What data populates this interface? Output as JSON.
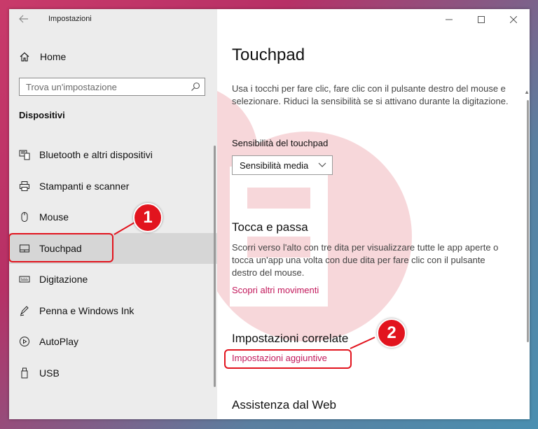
{
  "window": {
    "title": "Impostazioni",
    "controls": [
      "minimize-icon",
      "maximize-icon",
      "close-icon"
    ]
  },
  "sidebar": {
    "home_label": "Home",
    "search_placeholder": "Trova un'impostazione",
    "section_label": "Dispositivi",
    "items": [
      {
        "label": "Bluetooth e altri dispositivi",
        "icon": "bluetooth-devices-icon"
      },
      {
        "label": "Stampanti e scanner",
        "icon": "printer-icon"
      },
      {
        "label": "Mouse",
        "icon": "mouse-icon"
      },
      {
        "label": "Touchpad",
        "icon": "touchpad-icon",
        "selected": true
      },
      {
        "label": "Digitazione",
        "icon": "keyboard-icon"
      },
      {
        "label": "Penna e Windows Ink",
        "icon": "pen-icon"
      },
      {
        "label": "AutoPlay",
        "icon": "autoplay-icon"
      },
      {
        "label": "USB",
        "icon": "usb-icon"
      }
    ]
  },
  "main": {
    "title": "Touchpad",
    "intro": "Usa i tocchi per fare clic, fare clic con il pulsante destro del mouse e selezionare. Riduci la sensibilità se si attivano durante la digitazione.",
    "sensitivity_label": "Sensibilità del touchpad",
    "sensitivity_value": "Sensibilità media",
    "swipe_title": "Tocca e passa",
    "swipe_desc": "Scorri verso l'alto con tre dita per visualizzare tutte le app aperte o tocca un'app una volta con due dita per fare clic con il pulsante destro del mouse.",
    "swipe_link": "Scopri altri movimenti",
    "related_title": "Impostazioni correlate",
    "related_link": "Impostazioni aggiuntive",
    "web_title": "Assistenza dal Web"
  },
  "annotations": {
    "badge_1": "1",
    "badge_2": "2",
    "color": "#e2141e"
  },
  "colors": {
    "accent_link": "#c2185b",
    "sidebar_bg": "#ececec",
    "selected_bg": "#d6d6d6"
  }
}
